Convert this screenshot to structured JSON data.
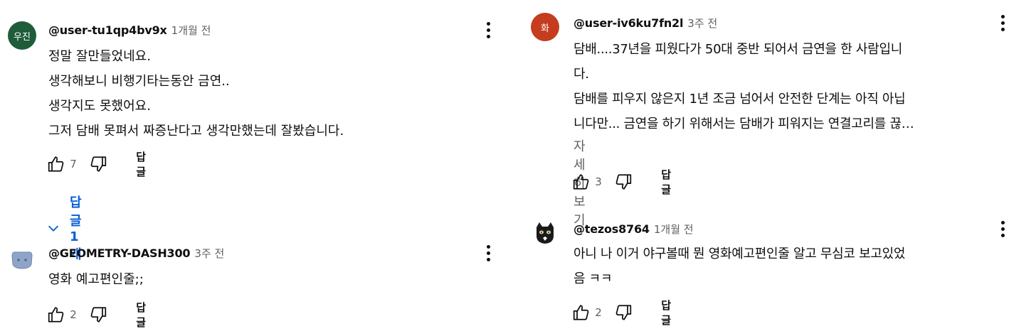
{
  "colors": {
    "link": "#065fd4",
    "muted": "#606060",
    "avatar_ujin": "#1e5c3a",
    "avatar_hwa": "#c53d1e",
    "avatar_geo": "#8ea4c8"
  },
  "icons": {
    "like": "thumbs-up-icon",
    "dislike": "thumbs-down-icon",
    "more": "vertical-dots-icon",
    "expand": "chevron-down-icon"
  },
  "comments": [
    {
      "avatar_text": "우진",
      "author": "@user-tu1qp4bv9x",
      "time": "1개월 전",
      "lines": [
        "정말 잘만들었네요.",
        "생각해보니 비행기타는동안 금연..",
        "생각지도 못했어요.",
        "그저 담배 못펴서 짜증난다고 생각만했는데 잘봤습니다."
      ],
      "likes": "7",
      "reply_label": "답글",
      "replies_label": "답글 1개"
    },
    {
      "author": "@GEOMETRY-DASH300",
      "time": "3주 전",
      "lines": [
        "영화 예고편인줄;;"
      ],
      "likes": "2",
      "reply_label": "답글"
    },
    {
      "avatar_text": "화",
      "author": "@user-iv6ku7fn2l",
      "time": "3주 전",
      "lines": [
        "담배....37년을 피웠다가 50대 중반 되어서 금연을 한 사람입니",
        "다.",
        "담배를 피우지 않은지 1년 조금 넘어서 안전한 단계는 아직 아닙",
        "니다만... 금연을 하기 위해서는 담배가 피워지는 연결고리를 끊…"
      ],
      "read_more": "자세히 보기",
      "likes": "3",
      "reply_label": "답글"
    },
    {
      "author": "@tezos8764",
      "time": "1개월 전",
      "lines": [
        "아니 나 이거 야구볼때 뭔 영화예고편인줄 알고 무심코 보고있었",
        "음 ㅋㅋ"
      ],
      "likes": "2",
      "reply_label": "답글"
    }
  ]
}
